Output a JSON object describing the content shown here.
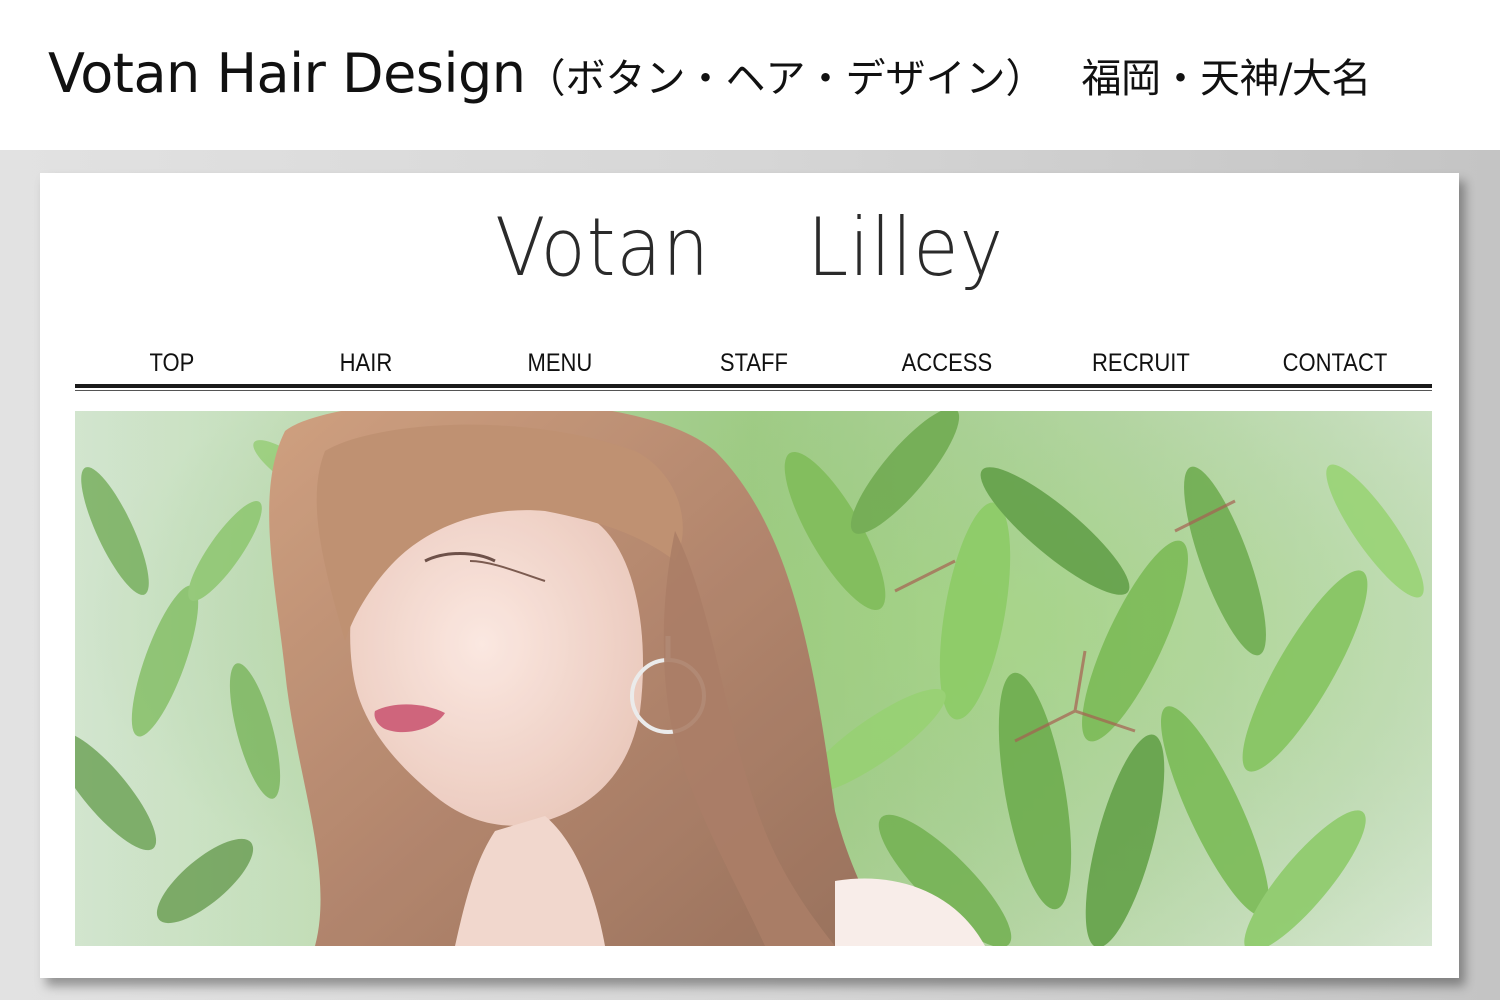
{
  "caption": {
    "title": "Votan Hair Design",
    "title_jp": "（ボタン・ヘア・デザイン）",
    "location": "福岡・天神/大名"
  },
  "site": {
    "logo": "Votan    Lilley",
    "nav": [
      {
        "label": "TOP"
      },
      {
        "label": "HAIR"
      },
      {
        "label": "MENU"
      },
      {
        "label": "STAFF"
      },
      {
        "label": "ACCESS"
      },
      {
        "label": "RECRUIT"
      },
      {
        "label": "CONTACT"
      }
    ]
  },
  "colors": {
    "text": "#111111",
    "logo": "#2a2a2a",
    "rule": "#1a1a1a",
    "leaf_green": "#5fa83a",
    "hair_brown": "#a9765a",
    "lips": "#c9506a"
  },
  "hero": {
    "image": "model-portrait-with-green-leaves"
  }
}
